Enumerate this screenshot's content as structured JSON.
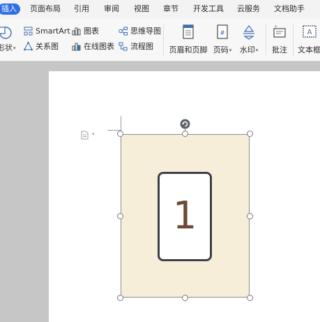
{
  "ribbon": {
    "tabs": [
      {
        "label": "插入",
        "active": true
      },
      {
        "label": "页面布局"
      },
      {
        "label": "引用"
      },
      {
        "label": "审阅"
      },
      {
        "label": "视图"
      },
      {
        "label": "章节"
      },
      {
        "label": "开发工具"
      },
      {
        "label": "云服务"
      },
      {
        "label": "文档助手"
      }
    ],
    "accent_color": "#2f6fe6"
  },
  "toolbar": {
    "shapes_label": "形状",
    "smartart_label": "SmartArt",
    "relation_label": "关系图",
    "chart_label": "图表",
    "online_chart_label": "在线图表",
    "mindmap_label": "思维导图",
    "flowchart_label": "流程图",
    "header_footer_label": "页眉和页脚",
    "page_number_label": "页码",
    "watermark_label": "水印",
    "comment_label": "批注",
    "textbox_label": "文本框"
  },
  "document": {
    "card_number": "1",
    "shape_fill": "#f7eeda"
  }
}
